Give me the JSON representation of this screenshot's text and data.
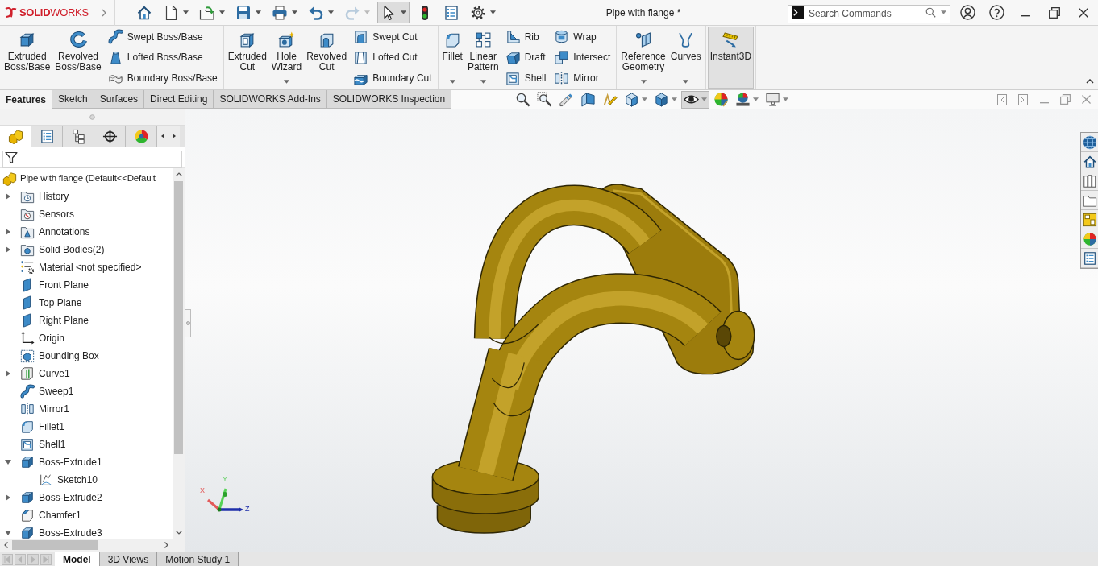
{
  "title_bar": {
    "logo": "**SOLID**WORKS",
    "quick_access": [
      {
        "kind": "home",
        "caret": false,
        "pressed": false,
        "disabled": false
      },
      {
        "kind": "new",
        "caret": true,
        "pressed": false,
        "disabled": false
      },
      {
        "kind": "open",
        "caret": true,
        "pressed": false,
        "disabled": false
      },
      {
        "kind": "save",
        "caret": true,
        "pressed": false,
        "disabled": false
      },
      {
        "kind": "print",
        "caret": true,
        "pressed": false,
        "disabled": false
      },
      {
        "kind": "undo",
        "caret": true,
        "pressed": false,
        "disabled": false
      },
      {
        "kind": "redo",
        "caret": true,
        "pressed": false,
        "disabled": true
      },
      {
        "kind": "select",
        "caret": true,
        "pressed": true,
        "disabled": false
      },
      {
        "kind": "rebuild",
        "caret": false,
        "pressed": false,
        "disabled": false
      },
      {
        "kind": "options",
        "caret": false,
        "pressed": false,
        "disabled": false
      },
      {
        "kind": "gear",
        "caret": true,
        "pressed": false,
        "disabled": false
      }
    ],
    "document_title": "Pipe with flange *",
    "search": {
      "placeholder": "Search Commands"
    }
  },
  "ribbon": {
    "groups": [
      {
        "columns": [
          {
            "kind": "large",
            "buttons": [
              {
                "kind": "extrude",
                "label": "Extruded Boss/Base",
                "caret": false,
                "pressed": false
              }
            ]
          },
          {
            "kind": "large",
            "buttons": [
              {
                "kind": "revolve",
                "label": "Revolved Boss/Base",
                "caret": false,
                "pressed": false
              }
            ]
          },
          {
            "kind": "stack",
            "buttons": [
              {
                "kind": "sweep",
                "label": "Swept Boss/Base",
                "caret": false,
                "pressed": false
              },
              {
                "kind": "loft",
                "label": "Lofted Boss/Base",
                "caret": false,
                "pressed": false
              },
              {
                "kind": "boundary",
                "label": "Boundary Boss/Base",
                "caret": false,
                "pressed": false
              }
            ]
          }
        ]
      },
      {
        "columns": [
          {
            "kind": "large",
            "buttons": [
              {
                "kind": "ext_cut",
                "label": "Extruded Cut",
                "caret": false,
                "pressed": false
              }
            ]
          },
          {
            "kind": "large",
            "buttons": [
              {
                "kind": "hole",
                "label": "Hole Wizard",
                "caret": true,
                "pressed": false
              }
            ]
          },
          {
            "kind": "large",
            "buttons": [
              {
                "kind": "rev_cut",
                "label": "Revolved Cut",
                "caret": false,
                "pressed": false
              }
            ]
          },
          {
            "kind": "stack",
            "buttons": [
              {
                "kind": "swept_cut",
                "label": "Swept Cut",
                "caret": false,
                "pressed": false
              },
              {
                "kind": "lofted_cut",
                "label": "Lofted Cut",
                "caret": false,
                "pressed": false
              },
              {
                "kind": "boundary_cut",
                "label": "Boundary Cut",
                "caret": false,
                "pressed": false
              }
            ]
          }
        ]
      },
      {
        "columns": [
          {
            "kind": "large",
            "buttons": [
              {
                "kind": "fillet",
                "label": "Fillet",
                "caret": true,
                "pressed": false
              }
            ]
          },
          {
            "kind": "large",
            "buttons": [
              {
                "kind": "pattern",
                "label": "Linear Pattern",
                "caret": true,
                "pressed": false
              }
            ]
          },
          {
            "kind": "stack",
            "buttons": [
              {
                "kind": "rib",
                "label": "Rib",
                "caret": false,
                "pressed": false
              },
              {
                "kind": "draft",
                "label": "Draft",
                "caret": false,
                "pressed": false
              },
              {
                "kind": "shell",
                "label": "Shell",
                "caret": false,
                "pressed": false
              }
            ]
          },
          {
            "kind": "stack",
            "buttons": [
              {
                "kind": "wrap",
                "label": "Wrap",
                "caret": false,
                "pressed": false
              },
              {
                "kind": "intersect",
                "label": "Intersect",
                "caret": false,
                "pressed": false
              },
              {
                "kind": "mirror",
                "label": "Mirror",
                "caret": false,
                "pressed": false
              }
            ]
          }
        ]
      },
      {
        "columns": [
          {
            "kind": "large",
            "buttons": [
              {
                "kind": "refgeom",
                "label": "Reference Geometry",
                "caret": true,
                "pressed": false
              }
            ]
          },
          {
            "kind": "large",
            "buttons": [
              {
                "kind": "curves",
                "label": "Curves",
                "caret": true,
                "pressed": false
              }
            ]
          }
        ]
      },
      {
        "columns": [
          {
            "kind": "large",
            "buttons": [
              {
                "kind": "instant3d",
                "label": "Instant3D",
                "caret": false,
                "pressed": true
              }
            ]
          }
        ]
      }
    ],
    "tabs": [
      {
        "label": "Features",
        "selected": true
      },
      {
        "label": "Sketch",
        "selected": false
      },
      {
        "label": "Surfaces",
        "selected": false
      },
      {
        "label": "Direct Editing",
        "selected": false
      },
      {
        "label": "SOLIDWORKS Add-Ins",
        "selected": false
      },
      {
        "label": "SOLIDWORKS Inspection",
        "selected": false
      }
    ]
  },
  "heads_up_toolbar": [
    {
      "kind": "zoom_fit",
      "caret": false,
      "pressed": false
    },
    {
      "kind": "zoom_area",
      "caret": false,
      "pressed": false
    },
    {
      "kind": "prev_view",
      "caret": false,
      "pressed": false
    },
    {
      "kind": "section",
      "caret": false,
      "pressed": false
    },
    {
      "kind": "dyn_annot",
      "caret": false,
      "pressed": false
    },
    {
      "kind": "orientation",
      "caret": true,
      "pressed": false
    },
    {
      "kind": "display_style",
      "caret": true,
      "pressed": false
    },
    {
      "kind": "hide_show",
      "caret": true,
      "pressed": true
    },
    {
      "kind": "appearance",
      "caret": false,
      "pressed": false
    },
    {
      "kind": "scene",
      "caret": true,
      "pressed": false
    },
    {
      "kind": "view_settings",
      "caret": true,
      "pressed": false
    }
  ],
  "feature_manager": {
    "panel_tabs": [
      {
        "kind": "feature_tree",
        "selected": true
      },
      {
        "kind": "property",
        "selected": false
      },
      {
        "kind": "config",
        "selected": false
      },
      {
        "kind": "dimxpert",
        "selected": false
      },
      {
        "kind": "display",
        "selected": false
      }
    ],
    "tree": {
      "root": {
        "label": "Pipe with flange (Default<<Default",
        "kind": "part"
      },
      "items": [
        {
          "label": "History",
          "kind": "history",
          "expandable": true,
          "expanded": false
        },
        {
          "label": "Sensors",
          "kind": "sensors",
          "expandable": false,
          "expanded": false
        },
        {
          "label": "Annotations",
          "kind": "annotations",
          "expandable": true,
          "expanded": false
        },
        {
          "label": "Solid Bodies(2)",
          "kind": "bodies",
          "expandable": true,
          "expanded": false
        },
        {
          "label": "Material <not specified>",
          "kind": "material",
          "expandable": false,
          "expanded": false
        },
        {
          "label": "Front Plane",
          "kind": "plane",
          "expandable": false,
          "expanded": false
        },
        {
          "label": "Top Plane",
          "kind": "plane",
          "expandable": false,
          "expanded": false
        },
        {
          "label": "Right Plane",
          "kind": "plane",
          "expandable": false,
          "expanded": false
        },
        {
          "label": "Origin",
          "kind": "origin",
          "expandable": false,
          "expanded": false
        },
        {
          "label": "Bounding Box",
          "kind": "bbox",
          "expandable": false,
          "expanded": false
        },
        {
          "label": "Curve1",
          "kind": "curve",
          "expandable": true,
          "expanded": false
        },
        {
          "label": "Sweep1",
          "kind": "sweep",
          "expandable": false,
          "expanded": false
        },
        {
          "label": "Mirror1",
          "kind": "mirror",
          "expandable": false,
          "expanded": false
        },
        {
          "label": "Fillet1",
          "kind": "fillet",
          "expandable": false,
          "expanded": false
        },
        {
          "label": "Shell1",
          "kind": "shell",
          "expandable": false,
          "expanded": false
        },
        {
          "label": "Boss-Extrude1",
          "kind": "extrude",
          "expandable": true,
          "expanded": true,
          "children": [
            {
              "label": "Sketch10",
              "kind": "sketch",
              "expandable": false,
              "expanded": false
            }
          ]
        },
        {
          "label": "Boss-Extrude2",
          "kind": "extrude",
          "expandable": true,
          "expanded": false
        },
        {
          "label": "Chamfer1",
          "kind": "chamfer",
          "expandable": false,
          "expanded": false
        },
        {
          "label": "Boss-Extrude3",
          "kind": "extrude",
          "expandable": true,
          "expanded": true
        }
      ]
    }
  },
  "viewport": {
    "triad": {
      "x": "X",
      "y": "Y",
      "z": "Z"
    }
  },
  "bottom_tabs": [
    {
      "label": "Model",
      "selected": true
    },
    {
      "label": "3D Views",
      "selected": false
    },
    {
      "label": "Motion Study 1",
      "selected": false
    }
  ]
}
